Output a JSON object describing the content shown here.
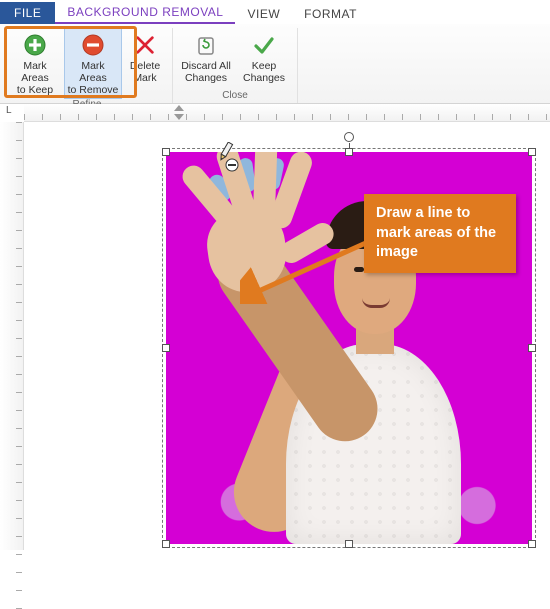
{
  "tabs": {
    "file": "FILE",
    "items": [
      "BACKGROUND REMOVAL",
      "VIEW",
      "FORMAT"
    ],
    "active_index": 0
  },
  "ribbon": {
    "groups": [
      {
        "name": "Refine",
        "buttons": [
          {
            "id": "mark-keep",
            "line1": "Mark Areas",
            "line2": "to Keep",
            "icon": "plus-circle"
          },
          {
            "id": "mark-remove",
            "line1": "Mark Areas",
            "line2": "to Remove",
            "icon": "minus-circle"
          },
          {
            "id": "delete-mark",
            "line1": "Delete",
            "line2": "Mark",
            "icon": "delete-x"
          }
        ]
      },
      {
        "name": "Close",
        "buttons": [
          {
            "id": "discard",
            "line1": "Discard All",
            "line2": "Changes",
            "icon": "recycle"
          },
          {
            "id": "keep",
            "line1": "Keep",
            "line2": "Changes",
            "icon": "check"
          }
        ]
      }
    ],
    "highlighted_button_ids": [
      "mark-keep",
      "mark-remove"
    ]
  },
  "callout": {
    "text": "Draw a line to mark areas of the image",
    "bg_color": "#e07a1f"
  },
  "cursor": {
    "type": "pencil-minus"
  },
  "image": {
    "removal_mask_color": "#d400d4"
  }
}
